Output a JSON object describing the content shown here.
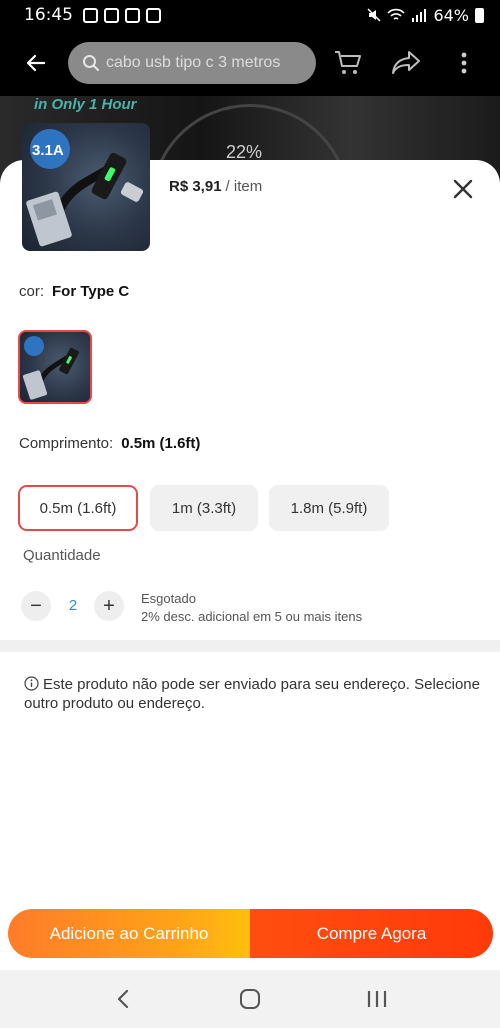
{
  "status_bar": {
    "time": "16:45",
    "battery": "64%"
  },
  "search": {
    "placeholder": "cabo usb tipo c 3 metros"
  },
  "banner": {
    "text": "in Only 1 Hour",
    "percent": "22%"
  },
  "product": {
    "price": "R$ 3,91",
    "unit": "/ item",
    "image_badge": "3.1A"
  },
  "color": {
    "label": "cor:",
    "value": "For Type C"
  },
  "length": {
    "label": "Comprimento:",
    "value": "0.5m (1.6ft)",
    "options": [
      "0.5m (1.6ft)",
      "1m (3.3ft)",
      "1.8m (5.9ft)"
    ]
  },
  "quantity": {
    "label": "Quantidade",
    "value": "2",
    "minus": "−",
    "plus": "+",
    "stock": "Esgotado",
    "discount": "2% desc. adicional em 5 ou mais itens"
  },
  "shipping": {
    "notice": "Este produto não pode ser enviado para seu endereço. Selecione outro produto ou endereço."
  },
  "actions": {
    "add_to_cart": "Adicione ao Carrinho",
    "buy_now": "Compre Agora"
  },
  "colors": {
    "accent": "#e34b4b",
    "cart_orange": "#ffa318",
    "buy_red": "#ff4e0f",
    "qty_blue": "#2c8ad9"
  }
}
